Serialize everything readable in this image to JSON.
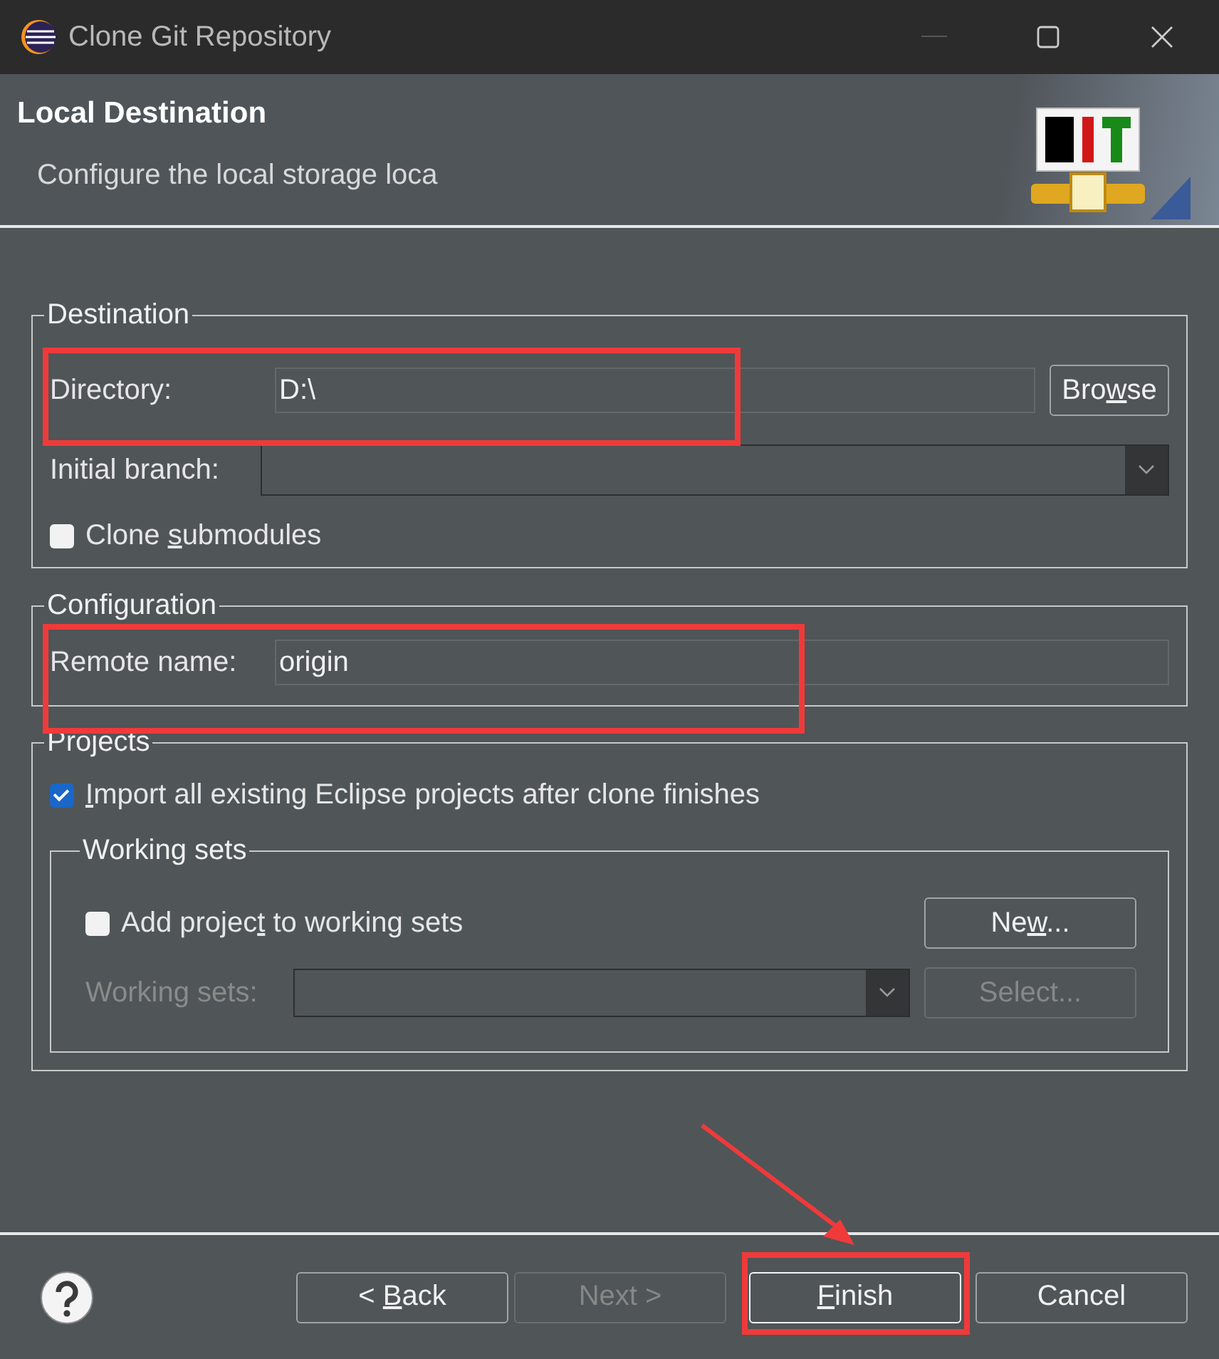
{
  "window": {
    "title": "Clone Git Repository"
  },
  "header": {
    "title": "Local Destination",
    "description": "Configure the local storage loca"
  },
  "destination": {
    "legend": "Destination",
    "directory": {
      "label": "Directory:",
      "value": "D:\\"
    },
    "browse": {
      "label": [
        {
          "text": "Bro",
          "mnemonic": false
        },
        {
          "text": "w",
          "mnemonic": true
        },
        {
          "text": "se",
          "mnemonic": false
        }
      ],
      "disabled": false
    },
    "initial_branch": {
      "label": "Initial branch:"
    },
    "clone_submodules": {
      "label": [
        {
          "text": "Clone ",
          "mnemonic": false
        },
        {
          "text": "s",
          "mnemonic": true
        },
        {
          "text": "ubmodules",
          "mnemonic": false
        }
      ],
      "checked": false
    }
  },
  "configuration": {
    "legend": "Configuration",
    "remote_name": {
      "label": "Remote name:",
      "value": "origin"
    }
  },
  "projects": {
    "legend": "Projects",
    "import": {
      "label": [
        {
          "text": "I",
          "mnemonic": true
        },
        {
          "text": "mport all existing Eclipse projects after clone finishes",
          "mnemonic": false
        }
      ],
      "checked": true
    },
    "working_sets": {
      "legend": "Working sets",
      "add": {
        "label": [
          {
            "text": "Add projec",
            "mnemonic": false
          },
          {
            "text": "t",
            "mnemonic": true
          },
          {
            "text": " to working sets",
            "mnemonic": false
          }
        ],
        "checked": false
      },
      "new_button": {
        "label": [
          {
            "text": "Ne",
            "mnemonic": false
          },
          {
            "text": "w",
            "mnemonic": true
          },
          {
            "text": "...",
            "mnemonic": false
          }
        ],
        "disabled": false
      },
      "sets_label": {
        "label": "Working sets:",
        "disabled": true
      },
      "select_button": {
        "label": [
          {
            "text": "Select...",
            "mnemonic": false
          }
        ],
        "disabled": true
      }
    }
  },
  "buttons": [
    {
      "label": [
        {
          "text": "< ",
          "mnemonic": false
        },
        {
          "text": "B",
          "mnemonic": true
        },
        {
          "text": "ack",
          "mnemonic": false
        }
      ],
      "disabled": false,
      "default": false
    },
    {
      "label": [
        {
          "text": "Next >",
          "mnemonic": false
        }
      ],
      "disabled": true,
      "default": false
    },
    {
      "label": [
        {
          "text": "F",
          "mnemonic": true
        },
        {
          "text": "inish",
          "mnemonic": false
        }
      ],
      "disabled": false,
      "default": true
    },
    {
      "label": [
        {
          "text": "Cancel",
          "mnemonic": false
        }
      ],
      "disabled": false,
      "default": false
    }
  ],
  "annotations": [
    {
      "kind": "frame"
    },
    {
      "kind": "frame"
    },
    {
      "kind": "arrow"
    },
    {
      "kind": "frame"
    }
  ]
}
